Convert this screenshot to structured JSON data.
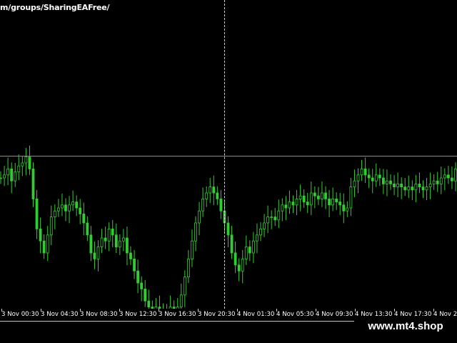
{
  "header": {
    "url_text": "m/groups/SharingEAFree/"
  },
  "watermark": {
    "text": "www.mt4.shop"
  },
  "colors": {
    "background": "#000000",
    "candle": "#32cd32",
    "crosshair": "#cfcfcf",
    "axis_text": "#ffffff"
  },
  "chart_data": {
    "type": "line",
    "title": "",
    "xlabel": "",
    "ylabel": "",
    "x_ticks": [
      "3 Nov 00:30",
      "3 Nov 04:30",
      "3 Nov 08:30",
      "3 Nov 12:30",
      "3 Nov 16:30",
      "3 Nov 20:30",
      "4 Nov 01:30",
      "4 Nov 05:30",
      "4 Nov 09:30",
      "4 Nov 13:30",
      "4 Nov 17:30",
      "4 Nov 2"
    ],
    "ylim": [
      0,
      100
    ],
    "series": [
      {
        "values": [
          55,
          56,
          58,
          54,
          57,
          59,
          60,
          62,
          58,
          48,
          38,
          34,
          30,
          36,
          42,
          44,
          45,
          46,
          44,
          46,
          47,
          45,
          43,
          40,
          36,
          30,
          28,
          32,
          35,
          34,
          38,
          36,
          32,
          34,
          35,
          30,
          28,
          24,
          20,
          18,
          14,
          12,
          10,
          12,
          11,
          9,
          10,
          12,
          10,
          12,
          16,
          22,
          28,
          34,
          40,
          44,
          48,
          50,
          52,
          50,
          48,
          44,
          40,
          36,
          30,
          26,
          24,
          28,
          32,
          30,
          34,
          36,
          38,
          40,
          42,
          42,
          41,
          44,
          46,
          45,
          47,
          46,
          48,
          49,
          47,
          46,
          50,
          49,
          48,
          50,
          48,
          46,
          48,
          47,
          46,
          44,
          45,
          52,
          54,
          56,
          58,
          56,
          55,
          54,
          56,
          55,
          53,
          54,
          53,
          52,
          53,
          52,
          51,
          52,
          51,
          53,
          52,
          51,
          52,
          53,
          54,
          53,
          55,
          56,
          55,
          54,
          58
        ]
      }
    ]
  }
}
